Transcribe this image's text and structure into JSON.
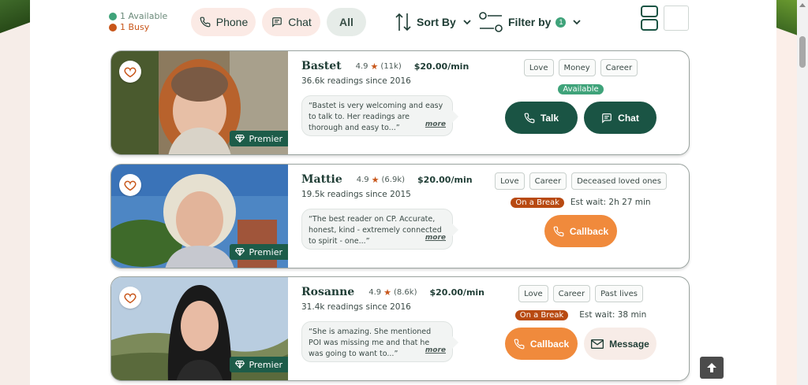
{
  "legend": {
    "available": "1 Available",
    "busy": "1 Busy",
    "available_color": "#3fa37a",
    "busy_color": "#c8561a"
  },
  "filters": {
    "phone_label": "Phone",
    "chat_label": "Chat",
    "all_label": "All",
    "sort_label": "Sort By",
    "filter_label": "Filter by",
    "filter_count": "1"
  },
  "readers": [
    {
      "name": "Bastet",
      "rating": "4.9",
      "reviews": "(11k)",
      "price": "$20.00/min",
      "readings": "36.6k readings since 2016",
      "quote": "“Bastet is very welcoming and easy to talk to. Her readings are thorough and easy to...”",
      "more": "more",
      "badge": "Premier",
      "tags": [
        "Love",
        "Money",
        "Career"
      ],
      "status": "Available",
      "wait": "",
      "buttons": [
        "Talk",
        "Chat"
      ]
    },
    {
      "name": "Mattie",
      "rating": "4.9",
      "reviews": "(6.9k)",
      "price": "$20.00/min",
      "readings": "19.5k readings since 2015",
      "quote": "“The best reader on CP. Accurate, honest, kind - extremely connected to spirit - one...”",
      "more": "more",
      "badge": "Premier",
      "tags": [
        "Love",
        "Career",
        "Deceased loved ones"
      ],
      "status": "On a Break",
      "wait": "Est wait: 2h 27 min",
      "buttons": [
        "Callback"
      ]
    },
    {
      "name": "Rosanne",
      "rating": "4.9",
      "reviews": "(8.6k)",
      "price": "$20.00/min",
      "readings": "31.4k readings since 2016",
      "quote": "“She is amazing. She mentioned POI was missing me and that he was going to want to...”",
      "more": "more",
      "badge": "Premier",
      "tags": [
        "Love",
        "Career",
        "Past lives"
      ],
      "status": "On a Break",
      "wait": "Est wait: 38 min",
      "buttons": [
        "Callback",
        "Message"
      ]
    }
  ],
  "colors": {
    "brand_green": "#1a5444",
    "callback_orange": "#f08a3c",
    "break_badge": "#b84a12"
  }
}
